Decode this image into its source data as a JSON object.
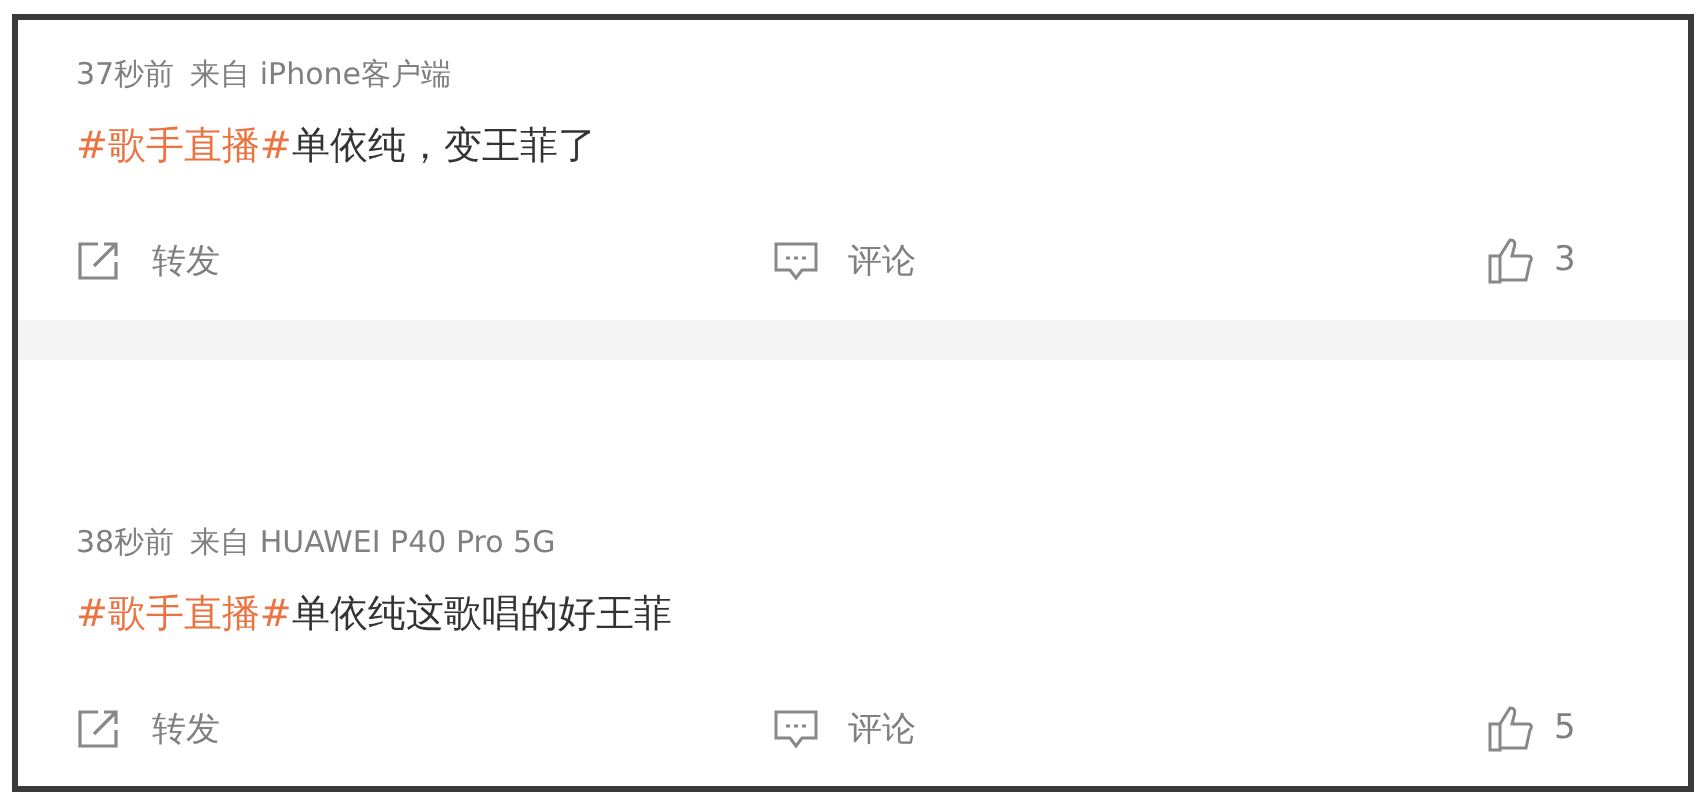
{
  "posts": [
    {
      "time": "37秒前",
      "source": "来自 iPhone客户端",
      "topic": "#歌手直播#",
      "text": "单依纯，变王菲了",
      "repost": "转发",
      "comment": "评论",
      "likes": "3"
    },
    {
      "time": "38秒前",
      "source": "来自 HUAWEI P40 Pro 5G",
      "topic": "#歌手直播#",
      "text": "单依纯这歌唱的好王菲",
      "repost": "转发",
      "comment": "评论",
      "likes": "5"
    }
  ]
}
